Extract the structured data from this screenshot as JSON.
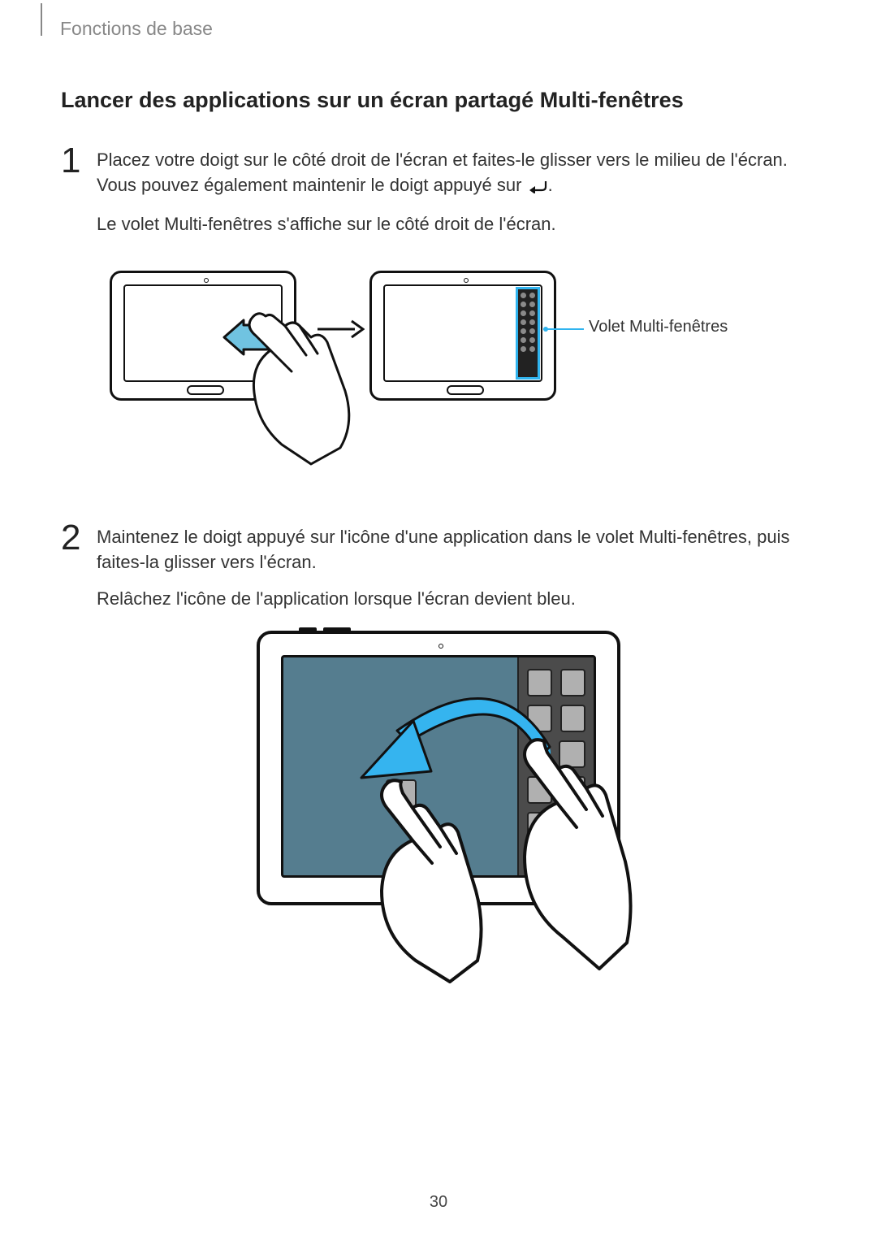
{
  "header": {
    "text": "Fonctions de base"
  },
  "title": "Lancer des applications sur un écran partagé Multi-fenêtres",
  "steps": [
    {
      "num": "1",
      "line1_pre": "Placez votre doigt sur le côté droit de l'écran et faites-le glisser vers le milieu de l'écran. Vous pouvez également maintenir le doigt appuyé sur ",
      "line1_post": ".",
      "line2": "Le volet Multi-fenêtres s'affiche sur le côté droit de l'écran."
    },
    {
      "num": "2",
      "line1": "Maintenez le doigt appuyé sur l'icône d'une application dans le volet Multi-fenêtres, puis faites-la glisser vers l'écran.",
      "line2": "Relâchez l'icône de l'application lorsque l'écran devient bleu."
    }
  ],
  "callout": {
    "label": "Volet Multi-fenêtres"
  },
  "page_number": "30"
}
